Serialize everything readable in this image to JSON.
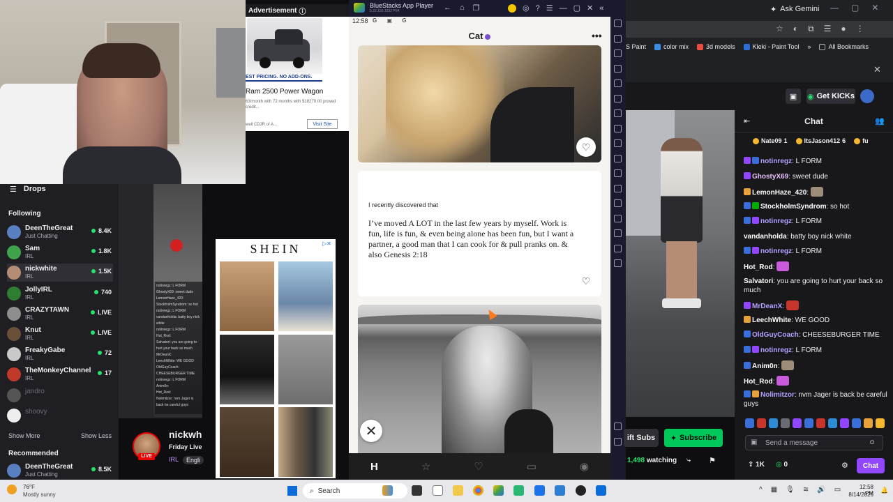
{
  "browser": {
    "gemini": "Ask Gemini",
    "bookmarks": [
      "S Paint",
      "color mix",
      "3d models",
      "Kleki - Paint Tool"
    ],
    "all_bookmarks": "All Bookmarks"
  },
  "twitch_top": {
    "kicks": "Get KICKs"
  },
  "sidebar": {
    "drops": "Drops",
    "following_title": "Following",
    "following": [
      {
        "name": "DeenTheGreat",
        "category": "Just Chatting",
        "viewers": "8.4K",
        "color": "#5a7fbf"
      },
      {
        "name": "Sam",
        "category": "IRL",
        "viewers": "1.8K",
        "color": "#3fa34d"
      },
      {
        "name": "nickwhite",
        "category": "IRL",
        "viewers": "1.5K",
        "color": "#b58d74"
      },
      {
        "name": "JollyIRL",
        "category": "IRL",
        "viewers": "740",
        "color": "#2e7d32"
      },
      {
        "name": "CRAZYTAWN",
        "category": "IRL",
        "viewers": "LIVE",
        "color": "#8e8e8e"
      },
      {
        "name": "Knut",
        "category": "IRL",
        "viewers": "LIVE",
        "color": "#6a4f3a"
      },
      {
        "name": "FreakyGabe",
        "category": "IRL",
        "viewers": "72",
        "color": "#c9c9c9"
      },
      {
        "name": "TheMonkeyChannel",
        "category": "IRL",
        "viewers": "17",
        "color": "#c0392b"
      },
      {
        "name": "jandro",
        "category": "",
        "viewers": "",
        "color": "#555"
      },
      {
        "name": "shoovy",
        "category": "",
        "viewers": "",
        "color": "#eee"
      }
    ],
    "show_more": "Show More",
    "show_less": "Show Less",
    "recommended_title": "Recommended",
    "recommended": [
      {
        "name": "DeenTheGreat",
        "category": "Just Chatting",
        "viewers": "8.5K",
        "color": "#5a7fbf"
      }
    ]
  },
  "ad_top": {
    "label": "Advertisement",
    "strip": "EST PRICING. NO ADD-ONS.",
    "title": "Ram 2500 Power Wagon",
    "sub": "63/month with 72 months with $18270.00 proved credit...",
    "dealer": "well CDJR of A...",
    "visit": "Visit Site"
  },
  "ad_shein": {
    "logo": "SHEIN"
  },
  "bluestacks": {
    "title": "BlueStacks App Player",
    "version": "5.22.150.1032 P64"
  },
  "phone": {
    "time": "12:58",
    "status_icons": "G ▣ G",
    "profile_name": "Cat",
    "prompt_question": "I recently discovered that",
    "prompt_answer": "I’ve moved A LOT in the last few years by myself. Work is fun, life is fun, & even being alone has been fun, but I want a partner, a good man that I can cook for & pull pranks on. & also Genesis 2:18"
  },
  "chat": {
    "title": "Chat",
    "gifters": [
      {
        "name": "Nate09",
        "count": "1"
      },
      {
        "name": "ItsJason412",
        "count": "6"
      },
      {
        "name": "fu",
        "count": ""
      }
    ],
    "messages": [
      {
        "user": "notinregz",
        "text": ": L FORM",
        "color": "#b4a1ff",
        "badge": "b-prime",
        "badge2": "b-sub"
      },
      {
        "user": "GhostyX69",
        "text": ": sweet dude",
        "color": "#e8c0ff",
        "badge": "b-prime",
        "badge2": ""
      },
      {
        "user": "LemonHaze_420",
        "text": ":",
        "color": "#ffffff",
        "badge": "b-bits",
        "badge2": ""
      },
      {
        "user": "StockholmSyndrom",
        "text": ": so hot",
        "color": "#ffffff",
        "badge": "b-sub",
        "badge2": "b-mod"
      },
      {
        "user": "notinregz",
        "text": ": L FORM",
        "color": "#b4a1ff",
        "badge": "b-sub",
        "badge2": "b-prime"
      },
      {
        "user": "vandanholda",
        "text": ": batty boy nick white",
        "color": "#ffffff",
        "badge": "",
        "badge2": ""
      },
      {
        "user": "notinregz",
        "text": ": L FORM",
        "color": "#b4a1ff",
        "badge": "b-sub",
        "badge2": "b-prime"
      },
      {
        "user": "Hot_Rod",
        "text": ":",
        "color": "#ffffff",
        "badge": "",
        "badge2": ""
      },
      {
        "user": "Salvatori",
        "text": ": you are going to hurt your back so much",
        "color": "#ffffff",
        "badge": "",
        "badge2": ""
      },
      {
        "user": "MrDeanX",
        "text": ":",
        "color": "#b4a1ff",
        "badge": "b-prime",
        "badge2": ""
      },
      {
        "user": "LeechWhite",
        "text": ": WE GOOD",
        "color": "#ffffff",
        "badge": "b-bits",
        "badge2": ""
      },
      {
        "user": "OldGuyCoach",
        "text": ": CHEESEBURGER TIME",
        "color": "#b4a1ff",
        "badge": "b-sub",
        "badge2": ""
      },
      {
        "user": "notinregz",
        "text": ": L FORM",
        "color": "#b4a1ff",
        "badge": "b-sub",
        "badge2": "b-prime"
      },
      {
        "user": "Anim0n",
        "text": ":",
        "color": "#ffffff",
        "badge": "b-sub",
        "badge2": ""
      },
      {
        "user": "Hot_Rod",
        "text": ":",
        "color": "#ffffff",
        "badge": "",
        "badge2": ""
      },
      {
        "user": "Nolimitzor",
        "text": ": nvm Jager is back be careful guys",
        "color": "#b4a1ff",
        "badge": "b-sub",
        "badge2": "b-bits"
      }
    ],
    "input_placeholder": "Send a message",
    "points": "1K",
    "bits": "0",
    "chat_button": "Chat"
  },
  "stream_info": {
    "streamer": "nickwh",
    "title": "Friday Live",
    "category": "IRL",
    "tag": "Engli",
    "live": "LIVE",
    "gift_subs": "ift Subs",
    "subscribe": "Subscribe",
    "watching_count": "1,498",
    "watching_label": "watching"
  },
  "taskbar": {
    "temp": "76°F",
    "weather": "Mostly sunny",
    "search": "Search",
    "time": "12:58 PM",
    "date": "8/14/2026"
  }
}
